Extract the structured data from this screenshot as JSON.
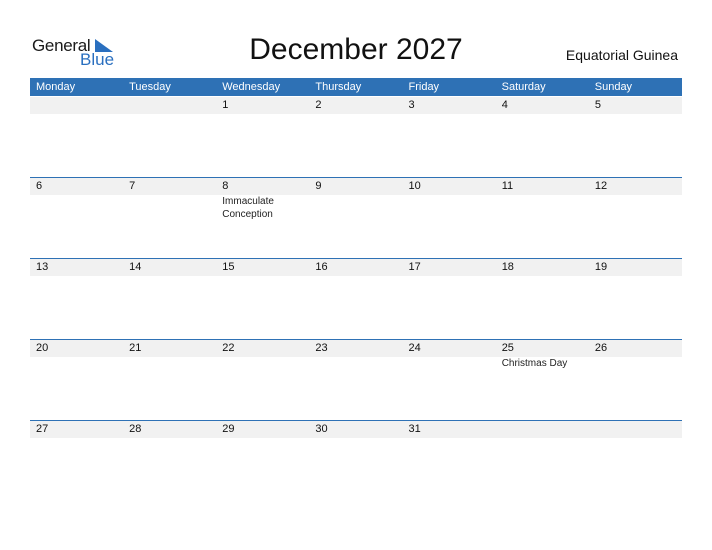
{
  "logo": {
    "word1": "General",
    "word2": "Blue"
  },
  "title": "December 2027",
  "country": "Equatorial Guinea",
  "colors": {
    "header_bg": "#2e71b5",
    "band_bg": "#f1f1f1"
  },
  "weekdays": [
    "Monday",
    "Tuesday",
    "Wednesday",
    "Thursday",
    "Friday",
    "Saturday",
    "Sunday"
  ],
  "weeks": [
    [
      {
        "day": ""
      },
      {
        "day": ""
      },
      {
        "day": "1"
      },
      {
        "day": "2"
      },
      {
        "day": "3"
      },
      {
        "day": "4"
      },
      {
        "day": "5"
      }
    ],
    [
      {
        "day": "6"
      },
      {
        "day": "7"
      },
      {
        "day": "8",
        "event": "Immaculate Conception"
      },
      {
        "day": "9"
      },
      {
        "day": "10"
      },
      {
        "day": "11"
      },
      {
        "day": "12"
      }
    ],
    [
      {
        "day": "13"
      },
      {
        "day": "14"
      },
      {
        "day": "15"
      },
      {
        "day": "16"
      },
      {
        "day": "17"
      },
      {
        "day": "18"
      },
      {
        "day": "19"
      }
    ],
    [
      {
        "day": "20"
      },
      {
        "day": "21"
      },
      {
        "day": "22"
      },
      {
        "day": "23"
      },
      {
        "day": "24"
      },
      {
        "day": "25",
        "event": "Christmas Day"
      },
      {
        "day": "26"
      }
    ],
    [
      {
        "day": "27"
      },
      {
        "day": "28"
      },
      {
        "day": "29"
      },
      {
        "day": "30"
      },
      {
        "day": "31"
      },
      {
        "day": ""
      },
      {
        "day": ""
      }
    ]
  ]
}
